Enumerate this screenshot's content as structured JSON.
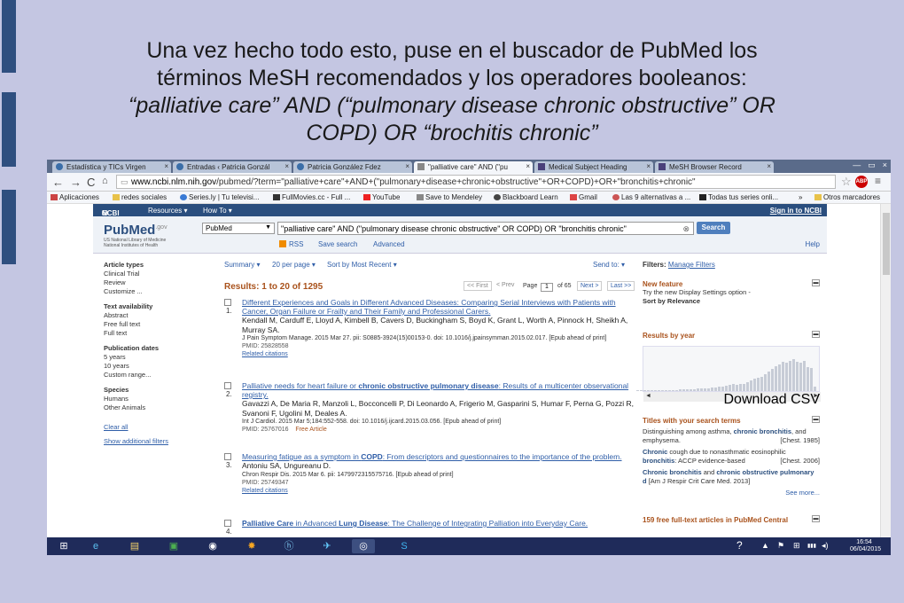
{
  "slide": {
    "line1": "Una vez hecho todo esto, puse en el buscador de PubMed los",
    "line2": "términos MeSH recomendados y los operadores booleanos:",
    "line3": "“palliative care” AND (“pulmonary disease chronic obstructive” OR",
    "line4": "COPD) OR “brochitis chronic”"
  },
  "browser": {
    "tabs": [
      "Estadística y TICs Virgen",
      "Entradas ‹ Patricia Gonzál",
      "Patricia González Fdez",
      "\"palliative care\" AND (\"pu",
      "Medical Subject Heading",
      "MeSH Browser Record"
    ],
    "tab_close": "×",
    "window_buttons": [
      "—",
      "▭",
      "×"
    ],
    "url_domain": "www.ncbi.nlm.nih.gov",
    "url_path": "/pubmed/?term=\"palliative+care\"+AND+(\"pulmonary+disease+chronic+obstructive\"+OR+COPD)+OR+\"bronchitis+chronic\"",
    "abp": "ABP",
    "bookmarks": [
      "Aplicaciones",
      "redes sociales",
      "Series.ly | Tu televisi...",
      "FullMovies.cc - Full ...",
      "YouTube",
      "Save to Mendeley",
      "Blackboard Learn",
      "Gmail",
      "Las 9 alternativas a ...",
      "Todas tus series onli...",
      "»",
      "Otros marcadores"
    ]
  },
  "ncbi": {
    "brand": "NCBI",
    "resources": "Resources ▾",
    "howto": "How To ▾",
    "signin": "Sign in to NCBI"
  },
  "pubmed": {
    "logo": "PubMed",
    "logo_gov": ".gov",
    "logo_sub1": "US National Library of Medicine",
    "logo_sub2": "National Institutes of Health",
    "db": "PubMed",
    "query": "\"palliative care\" AND (\"pulmonary disease chronic obstructive\" OR COPD) OR \"bronchitis chronic\"",
    "search_button": "Search",
    "rss": "RSS",
    "save_search": "Save search",
    "advanced": "Advanced",
    "help": "Help"
  },
  "sidebar": {
    "article_types": {
      "heading": "Article types",
      "items": [
        "Clinical Trial",
        "Review",
        "Customize ..."
      ]
    },
    "text_availability": {
      "heading": "Text availability",
      "items": [
        "Abstract",
        "Free full text",
        "Full text"
      ]
    },
    "pub_dates": {
      "heading": "Publication dates",
      "items": [
        "5 years",
        "10 years",
        "Custom range..."
      ]
    },
    "species": {
      "heading": "Species",
      "items": [
        "Humans",
        "Other Animals"
      ]
    },
    "clear_all": "Clear all",
    "show_additional": "Show additional filters"
  },
  "results_bar": {
    "summary": "Summary ▾",
    "per_page": "20 per page ▾",
    "sort": "Sort by Most Recent ▾",
    "send_to": "Send to: ▾",
    "count": "Results: 1 to 20 of 1295",
    "first": "<< First",
    "prev": "< Prev",
    "page": "Page",
    "page_num": "1",
    "of": "of 65",
    "next": "Next >",
    "last": "Last >>"
  },
  "results": [
    {
      "num": "1.",
      "title": "Different Experiences and Goals in Different Advanced Diseases: Comparing Serial Interviews with Patients with Cancer, Organ Failure or Frailty and Their Family and Professional Carers.",
      "authors": "Kendall M, Carduff E, Lloyd A, Kimbell B, Cavers D, Buckingham S, Boyd K, Grant L, Worth A, Pinnock H, Sheikh A, Murray SA.",
      "journal": "J Pain Symptom Manage. 2015 Mar 27. pii: S0885-3924(15)00153-0. doi: 10.1016/j.jpainsymman.2015.02.017. [Epub ahead of print]",
      "pmid": "PMID: 25828558",
      "related": "Related citations",
      "free": ""
    },
    {
      "num": "2.",
      "title": "Palliative needs for heart failure or chronic obstructive pulmonary disease: Results of a multicenter observational registry.",
      "authors": "Gavazzi A, De Maria R, Manzoli L, Bocconcelli P, Di Leonardo A, Frigerio M, Gasparini S, Humar F, Perna G, Pozzi R, Svanoni F, Ugolini M, Deales A.",
      "journal": "Int J Cardiol. 2015 Mar 5;184:552-558. doi: 10.1016/j.ijcard.2015.03.056. [Epub ahead of print]",
      "pmid": "PMID: 25767016",
      "related": "",
      "free": "Free Article"
    },
    {
      "num": "3.",
      "title": "Measuring fatigue as a symptom in COPD: From descriptors and questionnaires to the importance of the problem.",
      "authors": "Antoniu SA, Ungureanu D.",
      "journal": "Chron Respir Dis. 2015 Mar 6. pii: 1479972315575716. [Epub ahead of print]",
      "pmid": "PMID: 25749347",
      "related": "Related citations",
      "free": ""
    },
    {
      "num": "4.",
      "title": "Palliative Care in Advanced Lung Disease: The Challenge of Integrating Palliation into Everyday Care.",
      "authors": "",
      "journal": "",
      "pmid": "",
      "related": "",
      "free": ""
    }
  ],
  "right": {
    "filters": "Filters:",
    "manage": "Manage Filters",
    "new_feature": {
      "heading": "New feature",
      "text": "Try the new Display Settings option -",
      "bold": "Sort by Relevance"
    },
    "by_year": {
      "heading": "Results by year",
      "download": "Download CSV",
      "values": [
        1,
        1,
        1,
        1,
        1,
        1,
        2,
        2,
        2,
        2,
        2,
        2,
        3,
        3,
        3,
        4,
        4,
        5,
        5,
        6,
        6,
        7,
        8,
        9,
        10,
        11,
        12,
        14,
        13,
        14,
        15,
        18,
        22,
        25,
        28,
        30,
        34,
        40,
        46,
        52,
        55,
        60,
        58,
        62,
        66,
        60,
        58,
        62,
        50,
        48,
        10
      ],
      "arrows": [
        "◄",
        "►"
      ]
    },
    "titles": {
      "heading": "Titles with your search terms",
      "items": [
        {
          "a": "Distinguishing among asthma, ",
          "b": "chronic bronchitis",
          "c": ", and emphysema.",
          "src": "[Chest. 1985]"
        },
        {
          "a": "",
          "b": "Chronic",
          "c": " cough due to nonasthmatic eosinophilic ",
          "b2": "bronchitis",
          "c2": ": ACCP evidence-based",
          "src": "[Chest. 2006]"
        },
        {
          "a": "",
          "b": "Chronic bronchitis",
          "c": " and ",
          "b2": "chronic obstructive pulmonary d",
          "c2": "",
          "src": "[Am J Respir Crit Care Med. 2013]"
        }
      ],
      "see_more": "See more..."
    },
    "free": {
      "heading": "159 free full-text articles in PubMed Central"
    }
  },
  "taskbar": {
    "tray": [
      "?",
      "▲",
      "⚑",
      "⊞",
      "▮▮▮",
      "◂)"
    ],
    "time": "16:54",
    "date": "06/04/2015"
  }
}
